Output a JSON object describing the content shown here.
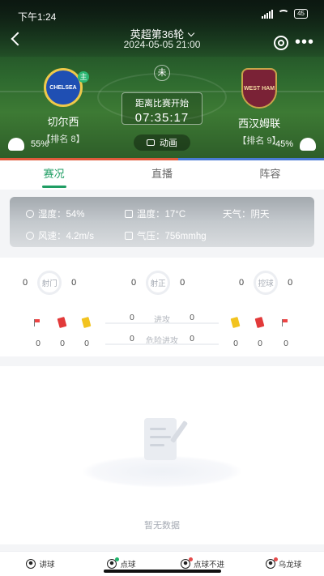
{
  "status_bar": {
    "time": "下午1:24",
    "battery": "45"
  },
  "nav": {
    "title": "英超第36轮",
    "datetime": "2024-05-05 21:00"
  },
  "match": {
    "status": "未",
    "countdown_label": "距离比赛开始",
    "countdown": "07:35:17",
    "animation_label": "动画",
    "home": {
      "name": "切尔西",
      "rank": "【排名 8】",
      "crest_text": "CHELSEA",
      "home_badge": "主",
      "possession": "55%",
      "possession_value": 55
    },
    "away": {
      "name": "西汉姆联",
      "rank": "【排名 9】",
      "crest_text": "WEST HAM",
      "possession": "45%",
      "possession_value": 45
    }
  },
  "tabs": [
    {
      "label": "赛况",
      "active": true
    },
    {
      "label": "直播",
      "active": false
    },
    {
      "label": "阵容",
      "active": false
    }
  ],
  "weather": {
    "humidity": "湿度：54%",
    "temperature": "温度：17°C",
    "weather": "天气：阴天",
    "wind": "风速：4.2m/s",
    "pressure": "气压：756mmhg"
  },
  "stats": {
    "rings": [
      {
        "label": "射门",
        "home": "0",
        "away": "0"
      },
      {
        "label": "射正",
        "home": "0",
        "away": "0"
      },
      {
        "label": "控球",
        "home": "0",
        "away": "0"
      }
    ],
    "attacks": [
      {
        "label": "进攻",
        "home": "0",
        "away": "0"
      },
      {
        "label": "危险进攻",
        "home": "0",
        "away": "0"
      }
    ],
    "home_events": {
      "corners": "0",
      "red": "0",
      "yellow": "0"
    },
    "away_events": {
      "yellow": "0",
      "red": "0",
      "corners": "0"
    }
  },
  "empty_text": "暂无数据",
  "bottom_bar": [
    {
      "label": "讲球",
      "icon": "ball-icon"
    },
    {
      "label": "点球",
      "icon": "ball-green-icon"
    },
    {
      "label": "点球不进",
      "icon": "ball-red-icon"
    },
    {
      "label": "乌龙球",
      "icon": "ball-red-icon"
    }
  ],
  "colors": {
    "accent": "#1f9d63",
    "home_bar": "#e05a3c",
    "away_bar": "#4a7bd4"
  }
}
